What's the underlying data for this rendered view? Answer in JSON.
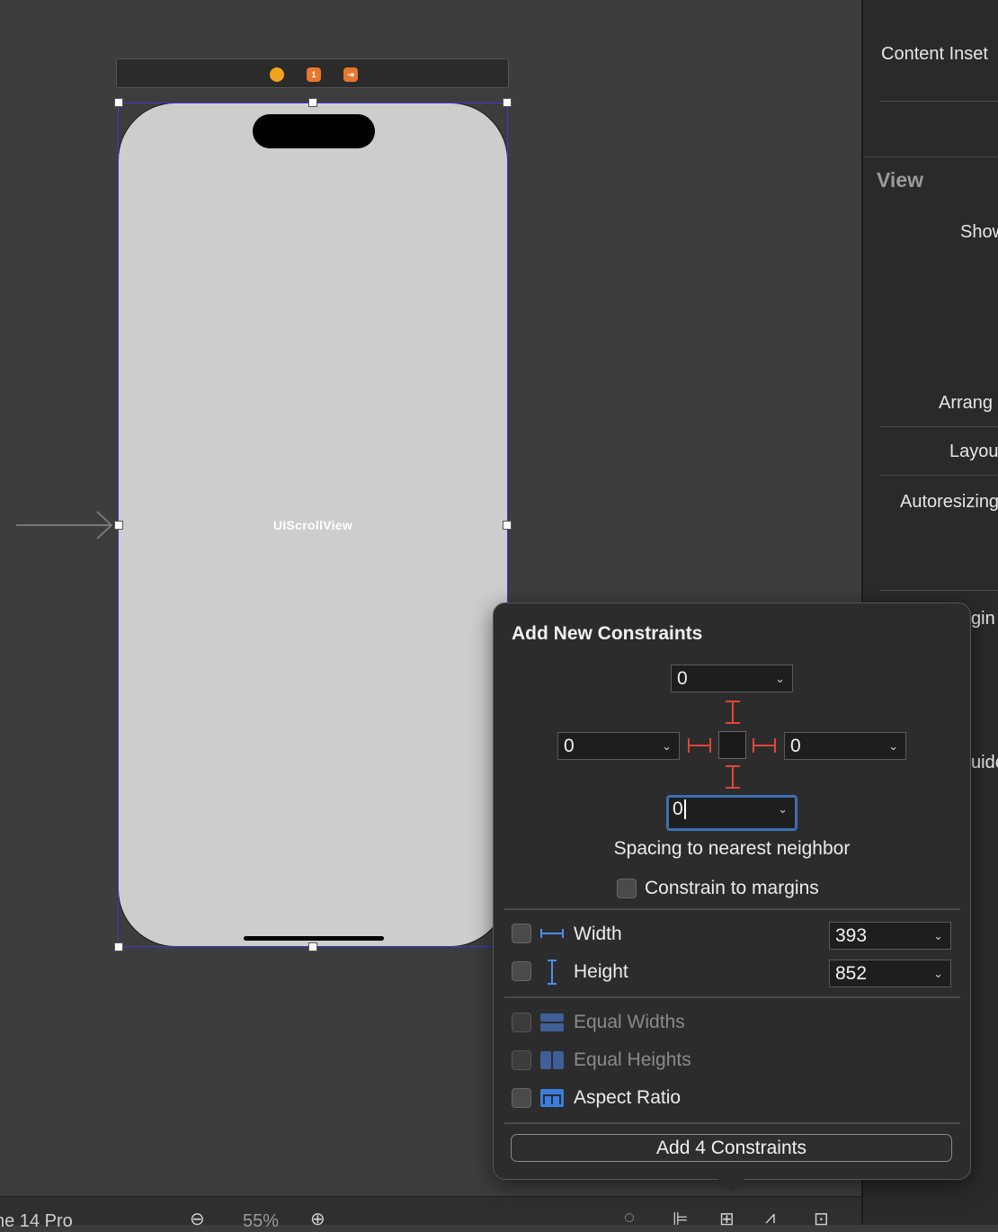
{
  "canvas": {
    "view_label": "UIScrollView"
  },
  "inspector": {
    "content_inset_label": "Content Inset",
    "view_section": "View",
    "show_label": "Show",
    "arrange_label": "Arrang",
    "layout_label": "Layou",
    "autoresizing_label": "Autoresizing",
    "margins_label": "gin",
    "guides_label": "uide"
  },
  "bottom_bar": {
    "device_label": "ne 14 Pro",
    "zoom": "55%"
  },
  "popover": {
    "title": "Add New Constraints",
    "top_value": "0",
    "leading_value": "0",
    "trailing_value": "0",
    "bottom_value": "0",
    "spacing_caption": "Spacing to nearest neighbor",
    "constrain_margins_label": "Constrain to margins",
    "width_label": "Width",
    "width_value": "393",
    "height_label": "Height",
    "height_value": "852",
    "equal_widths_label": "Equal Widths",
    "equal_heights_label": "Equal Heights",
    "aspect_ratio_label": "Aspect Ratio",
    "add_button_label": "Add 4 Constraints"
  },
  "colors": {
    "accent_blue": "#3b6fb3",
    "strut_red": "#e0443a",
    "device_fill": "#cdcdcd"
  }
}
